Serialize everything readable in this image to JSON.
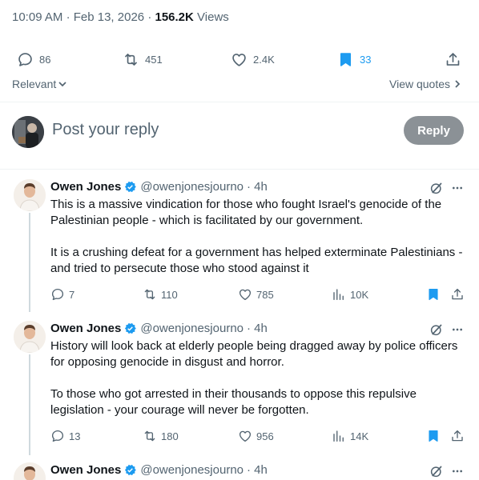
{
  "header": {
    "time": "10:09 AM",
    "separator": "·",
    "date": "Feb 13, 2026",
    "views_count": "156.2K",
    "views_label": "Views"
  },
  "main_actions": {
    "replies": "86",
    "reposts": "451",
    "likes": "2.4K",
    "bookmarks": "33"
  },
  "sort": {
    "label": "Relevant",
    "view_quotes": "View quotes"
  },
  "composer": {
    "placeholder": "Post your reply",
    "button": "Reply"
  },
  "tweets": [
    {
      "name": "Owen Jones",
      "handle": "@owenjonesjourno",
      "time": "· 4h",
      "paragraphs": [
        "This is a massive vindication for those who fought Israel's genocide of the Palestinian people - which is facilitated by our government.",
        "It is a crushing defeat for a government has helped exterminate Palestinians - and tried to persecute those who stood against it"
      ],
      "replies": "7",
      "reposts": "110",
      "likes": "785",
      "views": "10K"
    },
    {
      "name": "Owen Jones",
      "handle": "@owenjonesjourno",
      "time": "· 4h",
      "paragraphs": [
        "History will look back at elderly people being dragged away by police officers for opposing genocide in disgust and horror.",
        "To those who got arrested in their thousands to oppose this repulsive legislation - your courage will never be forgotten."
      ],
      "replies": "13",
      "reposts": "180",
      "likes": "956",
      "views": "14K"
    },
    {
      "name": "Owen Jones",
      "handle": "@owenjonesjourno",
      "time": "· 4h"
    }
  ],
  "colors": {
    "accent": "#1d9bf0",
    "text": "#0f1419",
    "muted": "#536471",
    "reply_button": "#8b9196"
  }
}
